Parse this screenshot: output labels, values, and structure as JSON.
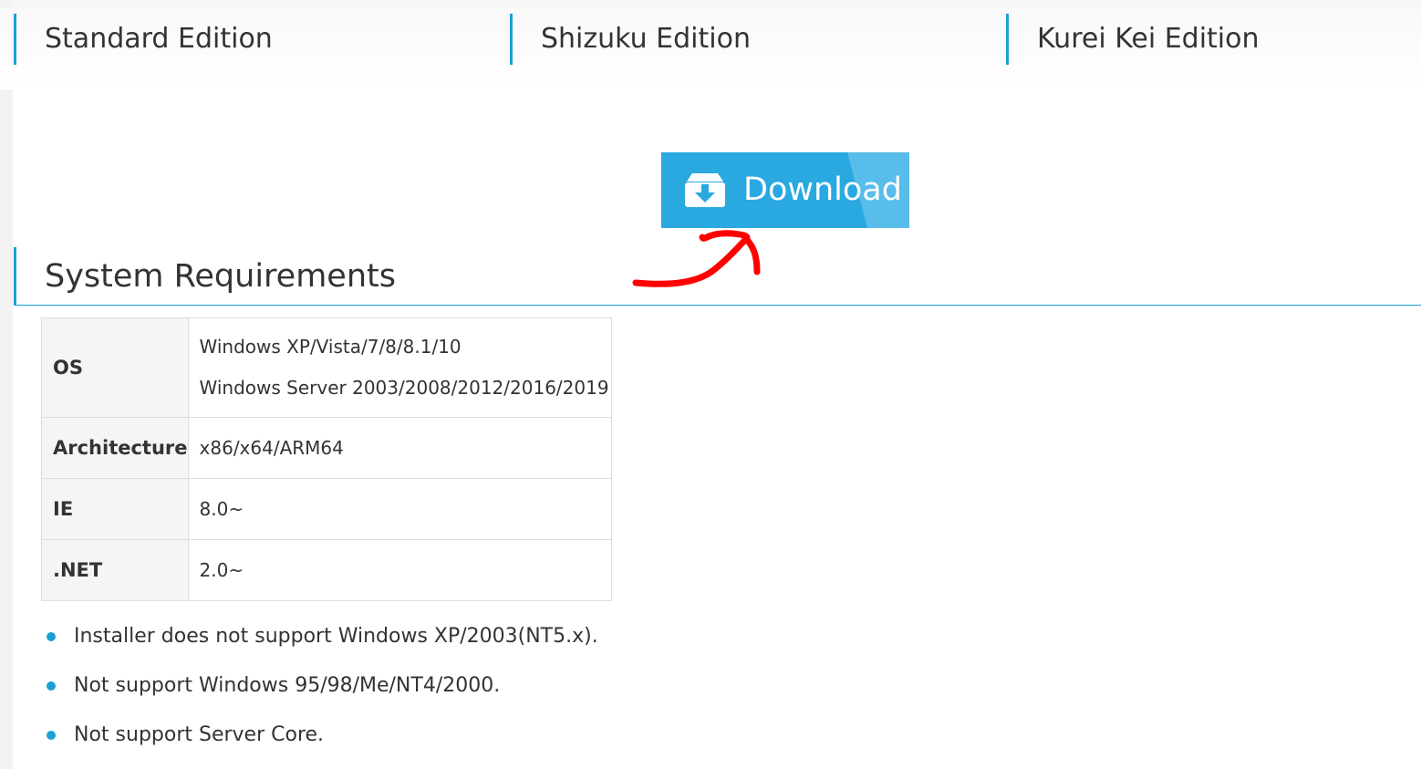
{
  "editions": [
    {
      "label": "Standard Edition"
    },
    {
      "label": "Shizuku Edition"
    },
    {
      "label": "Kurei Kei Edition"
    }
  ],
  "download": {
    "label": "Download",
    "icon": "download-box-icon",
    "color": "#2aa8e0"
  },
  "system_requirements": {
    "title": "System Requirements",
    "rows": [
      {
        "label": "OS",
        "values": [
          "Windows XP/Vista/7/8/8.1/10",
          "Windows Server 2003/2008/2012/2016/2019"
        ]
      },
      {
        "label": "Architecture",
        "values": [
          "x86/x64/ARM64"
        ]
      },
      {
        "label": "IE",
        "values": [
          "8.0~"
        ]
      },
      {
        "label": ".NET",
        "values": [
          "2.0~"
        ]
      }
    ],
    "notes": [
      "Installer does not support Windows XP/2003(NT5.x).",
      "Not support Windows 95/98/Me/NT4/2000.",
      "Not support Server Core."
    ]
  },
  "colors": {
    "accent": "#1ba0d6",
    "annotation": "#ff0000"
  }
}
